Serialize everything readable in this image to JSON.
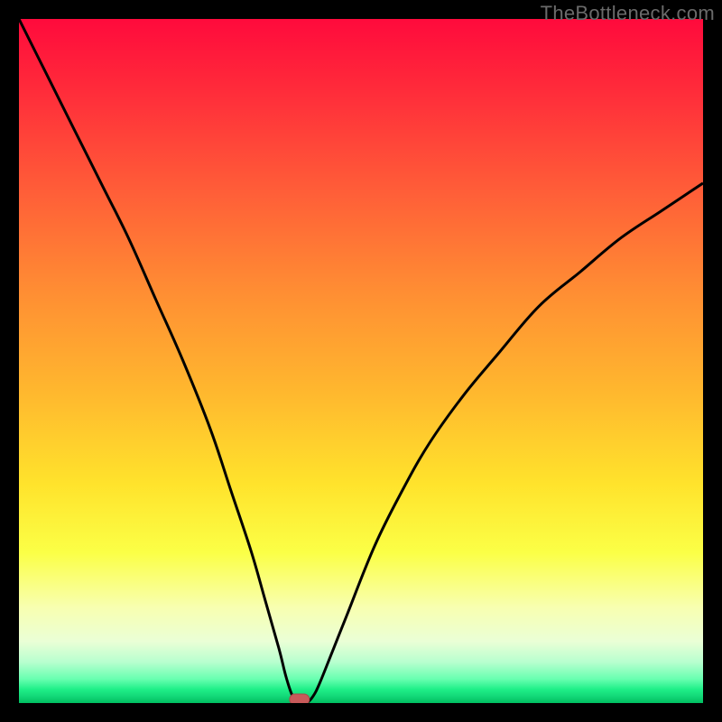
{
  "watermark": "TheBottleneck.com",
  "colors": {
    "frame": "#000000",
    "curve": "#000000",
    "marker_fill": "#c85a5a",
    "marker_stroke": "#a84a4a",
    "gradient_top": "#ff0a3c",
    "gradient_bottom": "#00be60"
  },
  "chart_data": {
    "type": "line",
    "title": "",
    "xlabel": "",
    "ylabel": "",
    "xlim": [
      0,
      100
    ],
    "ylim": [
      0,
      100
    ],
    "grid": false,
    "series": [
      {
        "name": "curve",
        "x": [
          0,
          4,
          8,
          12,
          16,
          20,
          24,
          28,
          31,
          34,
          36,
          38,
          39,
          40,
          41,
          42,
          43,
          44,
          46,
          48,
          52,
          56,
          60,
          65,
          70,
          76,
          82,
          88,
          94,
          100
        ],
        "y": [
          100,
          92,
          84,
          76,
          68,
          59,
          50,
          40,
          31,
          22,
          15,
          8,
          4,
          1,
          0,
          0,
          1,
          3,
          8,
          13,
          23,
          31,
          38,
          45,
          51,
          58,
          63,
          68,
          72,
          76
        ]
      }
    ],
    "marker": {
      "x": 41,
      "y": 0,
      "shape": "pill"
    },
    "legend": false
  }
}
